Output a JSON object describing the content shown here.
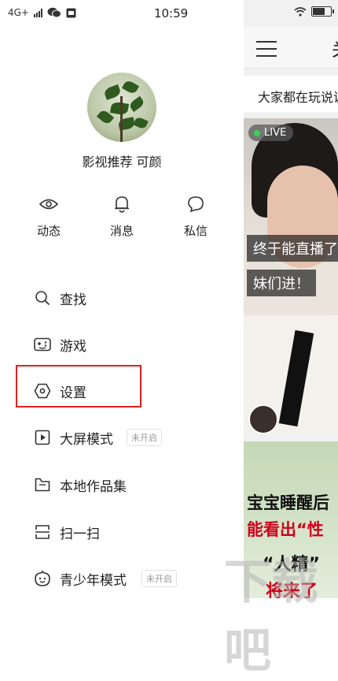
{
  "status_bar": {
    "network": "4G+",
    "time": "10:59"
  },
  "profile": {
    "name": "影视推荐 可颜"
  },
  "quick_actions": [
    {
      "label": "动态",
      "icon": "eye-icon"
    },
    {
      "label": "消息",
      "icon": "bell-icon"
    },
    {
      "label": "私信",
      "icon": "chat-bubble-icon"
    }
  ],
  "menu": [
    {
      "label": "查找",
      "icon": "search-icon"
    },
    {
      "label": "游戏",
      "icon": "gamepad-icon"
    },
    {
      "label": "设置",
      "icon": "hexagon-settings-icon"
    },
    {
      "label": "大屏模式",
      "icon": "play-square-icon",
      "badge": "未开启"
    },
    {
      "label": "本地作品集",
      "icon": "folder-icon"
    },
    {
      "label": "扫一扫",
      "icon": "scan-icon"
    },
    {
      "label": "青少年模式",
      "icon": "child-face-icon",
      "badge": "未开启"
    }
  ],
  "feed": {
    "top_title": "关",
    "marquee": "大家都在玩说说",
    "live_badge": "LIVE",
    "card1_caption_line1": "终于能直播了",
    "card1_caption_line2": "妹们进！",
    "card2_line1": "宝宝睡醒后",
    "card2_line2": "能看出“性",
    "card2_line3": "“人精”",
    "card2_line4": "将来了"
  },
  "watermark": "下载吧",
  "colors": {
    "highlight": "#e02020",
    "live_dot": "#39d353"
  },
  "battery_level": 0.75
}
